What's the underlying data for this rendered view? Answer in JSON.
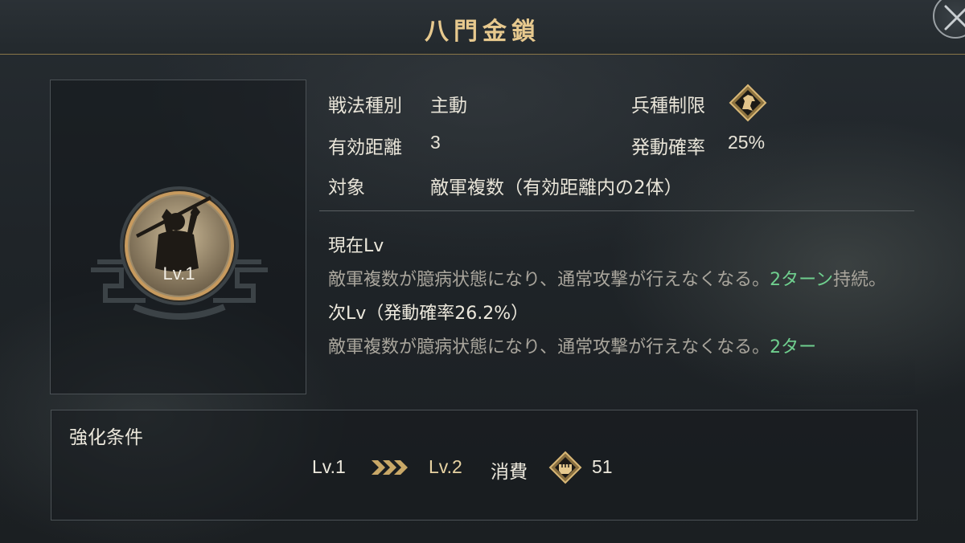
{
  "header": {
    "title": "八門金鎖"
  },
  "icons": {
    "close": "close-x-icon",
    "troop_type": "horse-icon",
    "arrows": "triple-chevron-right-icon",
    "cost": "fist-badge-icon"
  },
  "colors": {
    "accent_gold": "#e7c98e",
    "highlight_green": "#6fcf8e",
    "frame_gold": "#8a7648"
  },
  "skill": {
    "level_label": "Lv.1"
  },
  "stats": {
    "type_label": "戦法種別",
    "type_value": "主動",
    "troop_label": "兵種制限",
    "range_label": "有効距離",
    "range_value": "3",
    "rate_label": "発動確率",
    "rate_value": "25%",
    "target_label": "対象",
    "target_value": "敵軍複数（有効距離内の2体）"
  },
  "current": {
    "heading": "現在Lv",
    "body": "敵軍複数が臆病状態になり、通常攻撃が行えなくなる。",
    "highlight": "2ターン",
    "tail": "持続。"
  },
  "next": {
    "heading": "次Lv（発動確率26.2%）",
    "body": "敵軍複数が臆病状態になり、通常攻撃が行えなくなる。",
    "highlight": "2ター"
  },
  "upgrade": {
    "title": "強化条件",
    "from_level": "Lv.1",
    "to_level": "Lv.2",
    "cost_label": "消費",
    "cost_value": "51"
  }
}
